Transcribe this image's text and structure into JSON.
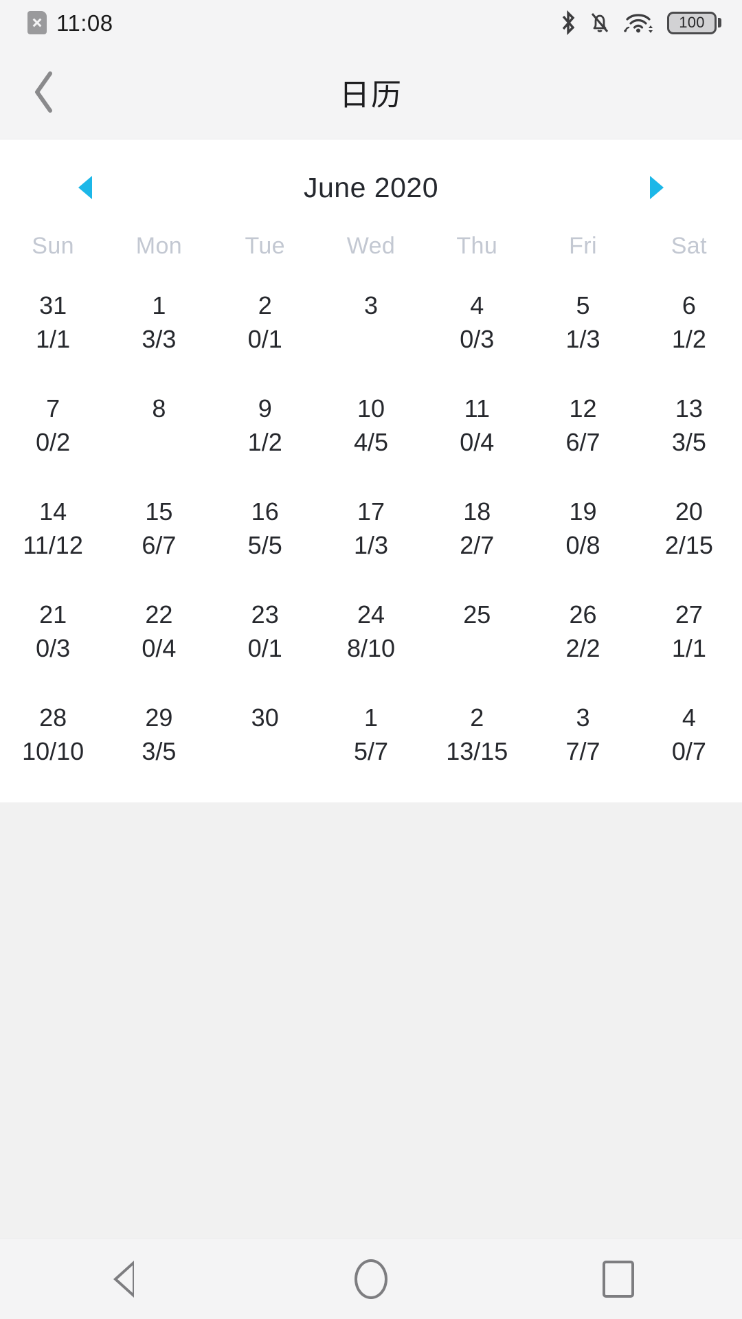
{
  "status_bar": {
    "time": "11:08",
    "battery_level": "100",
    "icons": [
      "sim-card-no-service-icon",
      "bluetooth-icon",
      "notifications-off-icon",
      "wifi-icon",
      "battery-icon"
    ]
  },
  "app_bar": {
    "title": "日历",
    "back_icon": "chevron-left-icon"
  },
  "calendar": {
    "month_label": "June 2020",
    "prev_icon": "triangle-left-icon",
    "next_icon": "triangle-right-icon",
    "accent_color": "#1cb7e8",
    "weekdays": [
      "Sun",
      "Mon",
      "Tue",
      "Wed",
      "Thu",
      "Fri",
      "Sat"
    ],
    "weeks": [
      [
        {
          "day": "31",
          "ratio": "1/1"
        },
        {
          "day": "1",
          "ratio": "3/3"
        },
        {
          "day": "2",
          "ratio": "0/1"
        },
        {
          "day": "3",
          "ratio": ""
        },
        {
          "day": "4",
          "ratio": "0/3"
        },
        {
          "day": "5",
          "ratio": "1/3"
        },
        {
          "day": "6",
          "ratio": "1/2"
        }
      ],
      [
        {
          "day": "7",
          "ratio": "0/2"
        },
        {
          "day": "8",
          "ratio": ""
        },
        {
          "day": "9",
          "ratio": "1/2"
        },
        {
          "day": "10",
          "ratio": "4/5"
        },
        {
          "day": "11",
          "ratio": "0/4"
        },
        {
          "day": "12",
          "ratio": "6/7"
        },
        {
          "day": "13",
          "ratio": "3/5"
        }
      ],
      [
        {
          "day": "14",
          "ratio": "11/12"
        },
        {
          "day": "15",
          "ratio": "6/7"
        },
        {
          "day": "16",
          "ratio": "5/5"
        },
        {
          "day": "17",
          "ratio": "1/3"
        },
        {
          "day": "18",
          "ratio": "2/7"
        },
        {
          "day": "19",
          "ratio": "0/8"
        },
        {
          "day": "20",
          "ratio": "2/15"
        }
      ],
      [
        {
          "day": "21",
          "ratio": "0/3"
        },
        {
          "day": "22",
          "ratio": "0/4"
        },
        {
          "day": "23",
          "ratio": "0/1"
        },
        {
          "day": "24",
          "ratio": "8/10"
        },
        {
          "day": "25",
          "ratio": ""
        },
        {
          "day": "26",
          "ratio": "2/2"
        },
        {
          "day": "27",
          "ratio": "1/1"
        }
      ],
      [
        {
          "day": "28",
          "ratio": "10/10"
        },
        {
          "day": "29",
          "ratio": "3/5"
        },
        {
          "day": "30",
          "ratio": ""
        },
        {
          "day": "1",
          "ratio": "5/7"
        },
        {
          "day": "2",
          "ratio": "13/15"
        },
        {
          "day": "3",
          "ratio": "7/7"
        },
        {
          "day": "4",
          "ratio": "0/7"
        }
      ]
    ]
  },
  "nav_bar": {
    "back_icon": "android-back-icon",
    "home_icon": "android-home-icon",
    "recents_icon": "android-recents-icon"
  }
}
